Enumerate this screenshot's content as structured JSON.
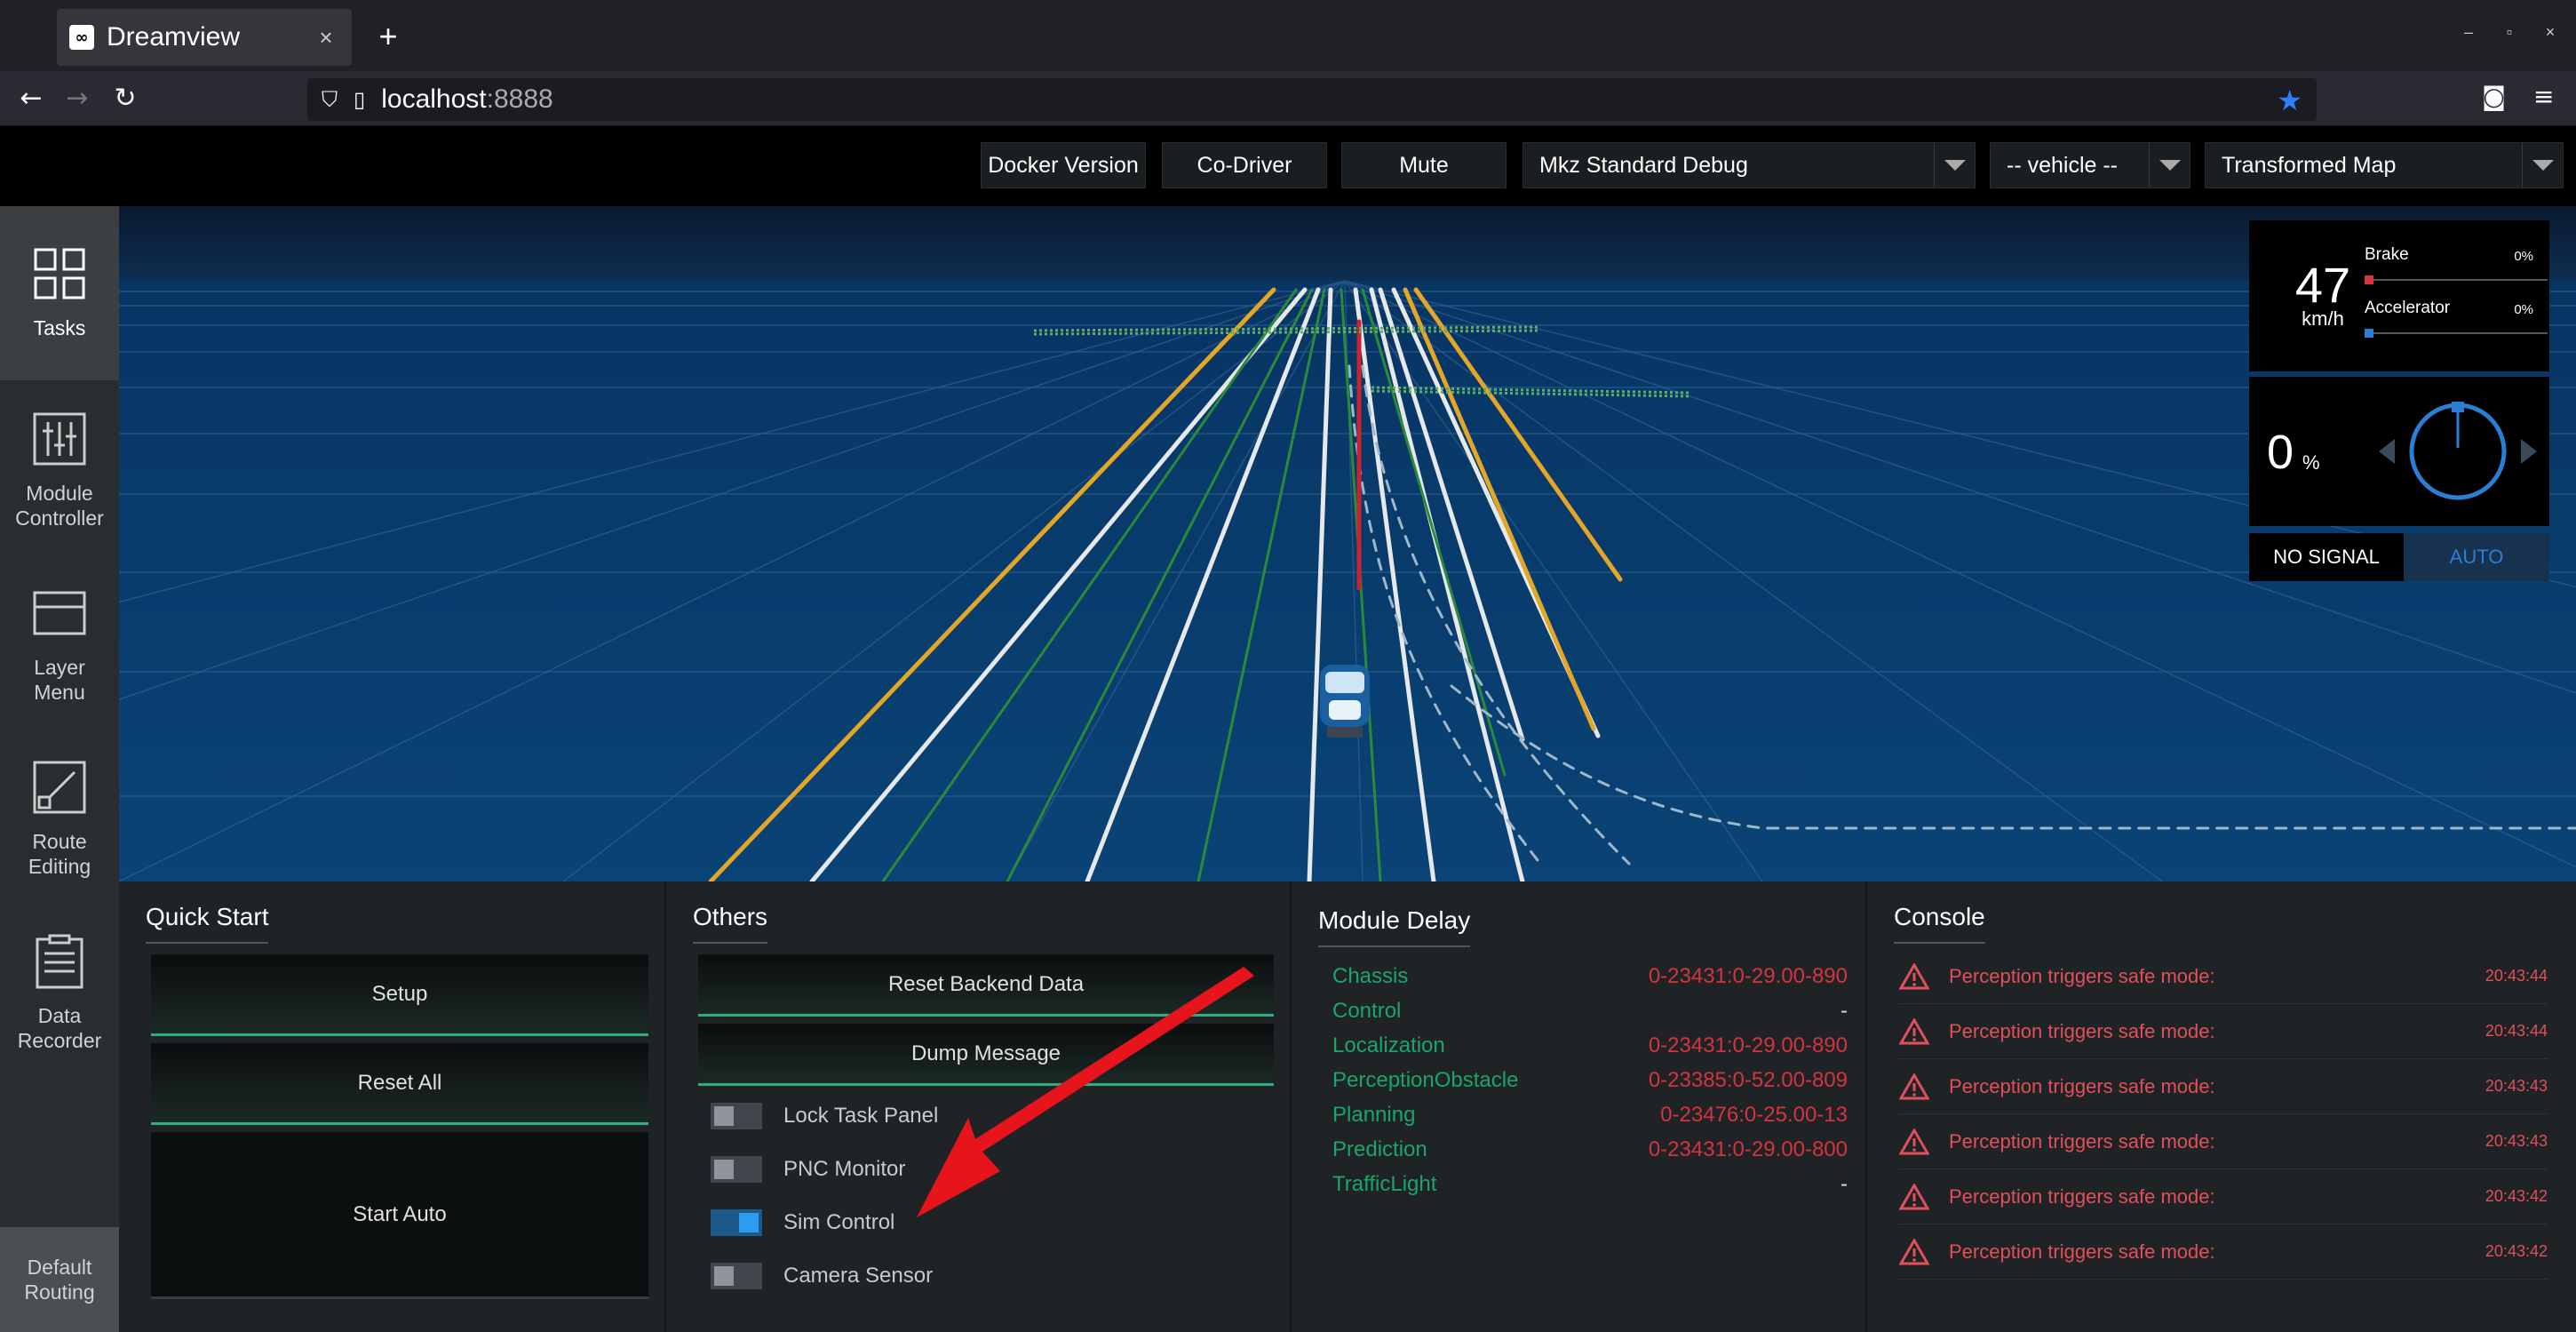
{
  "browser": {
    "tab_title": "Dreamview",
    "favicon": "dreamview-icon",
    "close_glyph": "×",
    "new_tab_glyph": "+",
    "url_host": "localhost",
    "url_port": ":8888"
  },
  "header": {
    "docker_version": "Docker Version",
    "co_driver": "Co-Driver",
    "mute": "Mute",
    "mode_select": "Mkz Standard Debug",
    "vehicle_select": "-- vehicle --",
    "map_select": "Transformed Map"
  },
  "sidenav": {
    "items": [
      {
        "label_line1": "Tasks",
        "label_line2": "",
        "icon": "grid-icon"
      },
      {
        "label_line1": "Module",
        "label_line2": "Controller",
        "icon": "sliders-icon"
      },
      {
        "label_line1": "Layer",
        "label_line2": "Menu",
        "icon": "layers-icon"
      },
      {
        "label_line1": "Route",
        "label_line2": "Editing",
        "icon": "route-icon"
      },
      {
        "label_line1": "Data",
        "label_line2": "Recorder",
        "icon": "clipboard-icon"
      }
    ],
    "bottom_line1": "Default",
    "bottom_line2": "Routing"
  },
  "hud": {
    "speed": "47",
    "speed_unit": "km/h",
    "brake_label": "Brake",
    "brake_pct": "0%",
    "brake_value": 0,
    "accel_label": "Accelerator",
    "accel_pct": "0%",
    "accel_value": 0,
    "steer": "0",
    "steer_unit": "%",
    "signal": "NO SIGNAL",
    "drive_mode": "AUTO",
    "colors": {
      "brake": "#d3343e",
      "accel": "#2a7fd4"
    }
  },
  "quick_start": {
    "title": "Quick Start",
    "setup": "Setup",
    "reset_all": "Reset All",
    "start_auto": "Start Auto"
  },
  "others": {
    "title": "Others",
    "reset_backend": "Reset Backend Data",
    "dump_message": "Dump Message",
    "toggles": [
      {
        "label": "Lock Task Panel",
        "on": false
      },
      {
        "label": "PNC Monitor",
        "on": false
      },
      {
        "label": "Sim Control",
        "on": true
      },
      {
        "label": "Camera Sensor",
        "on": false
      }
    ]
  },
  "module_delay": {
    "title": "Module Delay",
    "rows": [
      {
        "name": "Chassis",
        "value": "0-23431:0-29.00-890"
      },
      {
        "name": "Control",
        "value": "-"
      },
      {
        "name": "Localization",
        "value": "0-23431:0-29.00-890"
      },
      {
        "name": "PerceptionObstacle",
        "value": "0-23385:0-52.00-809"
      },
      {
        "name": "Planning",
        "value": "0-23476:0-25.00-13"
      },
      {
        "name": "Prediction",
        "value": "0-23431:0-29.00-800"
      },
      {
        "name": "TrafficLight",
        "value": "-"
      }
    ]
  },
  "console": {
    "title": "Console",
    "rows": [
      {
        "msg": "Perception triggers safe mode:",
        "time": "20:43:44"
      },
      {
        "msg": "Perception triggers safe mode:",
        "time": "20:43:44"
      },
      {
        "msg": "Perception triggers safe mode:",
        "time": "20:43:43"
      },
      {
        "msg": "Perception triggers safe mode:",
        "time": "20:43:43"
      },
      {
        "msg": "Perception triggers safe mode:",
        "time": "20:43:42"
      },
      {
        "msg": "Perception triggers safe mode:",
        "time": "20:43:42"
      }
    ]
  },
  "annotation": {
    "arrow_color": "#e8141b"
  }
}
